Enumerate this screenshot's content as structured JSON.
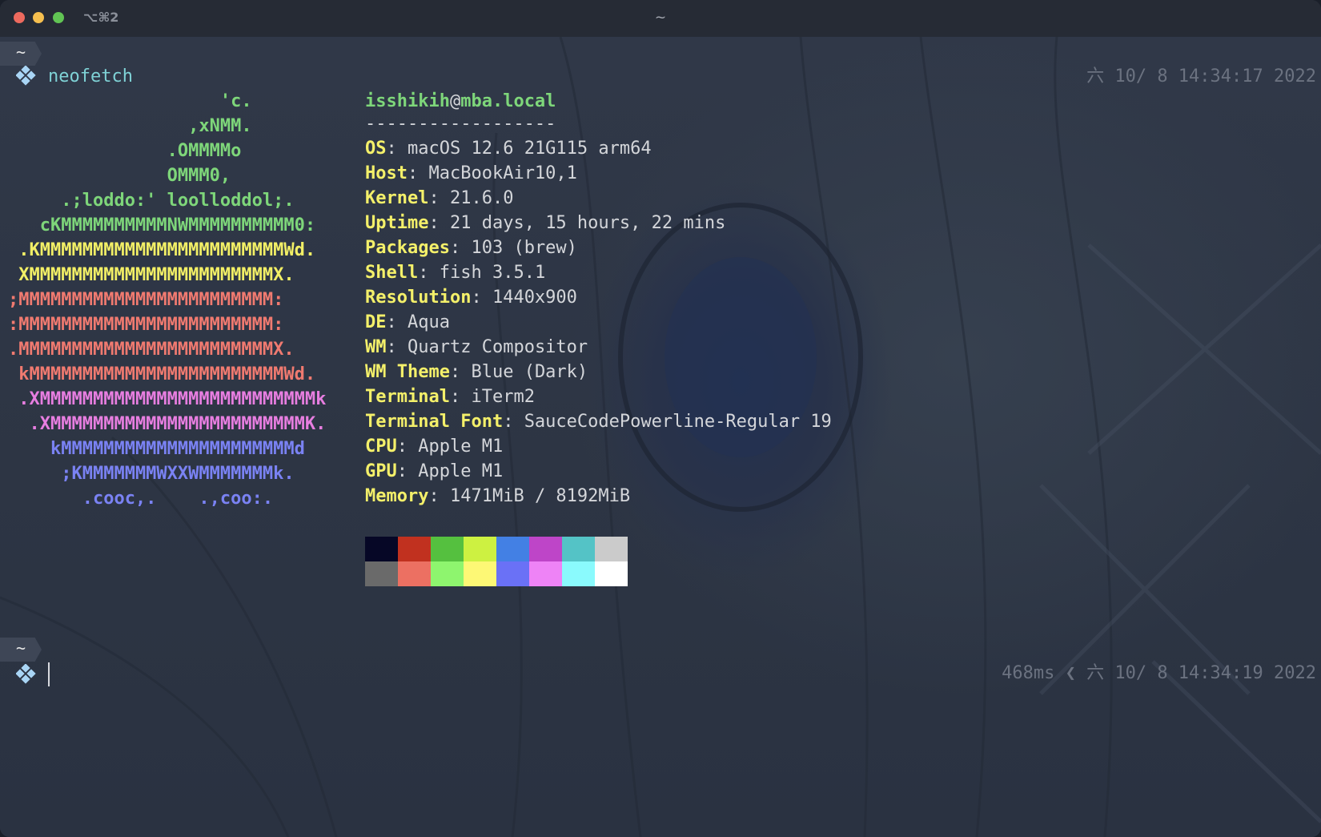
{
  "window": {
    "title": "~",
    "shortcut": "⌥⌘2"
  },
  "session1": {
    "cwd": "~",
    "command": "neofetch",
    "timestamp": "六 10/ 8 14:34:17 2022"
  },
  "ascii_logo": [
    {
      "text": "                    'c.",
      "color": "green"
    },
    {
      "text": "                 ,xNMM.",
      "color": "green"
    },
    {
      "text": "               .OMMMMo",
      "color": "green"
    },
    {
      "text": "               OMMM0,",
      "color": "green"
    },
    {
      "text": "     .;loddo:' loolloddol;.",
      "color": "green"
    },
    {
      "text": "   cKMMMMMMMMMMNWMMMMMMMMMM0:",
      "color": "green"
    },
    {
      "text": " .KMMMMMMMMMMMMMMMMMMMMMMMWd.",
      "color": "yellow"
    },
    {
      "text": " XMMMMMMMMMMMMMMMMMMMMMMMX.",
      "color": "yellow"
    },
    {
      "text": ";MMMMMMMMMMMMMMMMMMMMMMMM:",
      "color": "red"
    },
    {
      "text": ":MMMMMMMMMMMMMMMMMMMMMMMM:",
      "color": "red"
    },
    {
      "text": ".MMMMMMMMMMMMMMMMMMMMMMMMX.",
      "color": "red"
    },
    {
      "text": " kMMMMMMMMMMMMMMMMMMMMMMMMWd.",
      "color": "red"
    },
    {
      "text": " .XMMMMMMMMMMMMMMMMMMMMMMMMMMk",
      "color": "pink"
    },
    {
      "text": "  .XMMMMMMMMMMMMMMMMMMMMMMMMK.",
      "color": "pink"
    },
    {
      "text": "    kMMMMMMMMMMMMMMMMMMMMMMd",
      "color": "blue"
    },
    {
      "text": "     ;KMMMMMMMWXXWMMMMMMMk.",
      "color": "blue"
    },
    {
      "text": "       .cooc,.    .,coo:.",
      "color": "blue"
    }
  ],
  "sysinfo": {
    "user": "isshikih",
    "at": "@",
    "host": "mba.local",
    "separator": "------------------",
    "rows": [
      {
        "key": "OS",
        "value": "macOS 12.6 21G115 arm64"
      },
      {
        "key": "Host",
        "value": "MacBookAir10,1"
      },
      {
        "key": "Kernel",
        "value": "21.6.0"
      },
      {
        "key": "Uptime",
        "value": "21 days, 15 hours, 22 mins"
      },
      {
        "key": "Packages",
        "value": "103 (brew)"
      },
      {
        "key": "Shell",
        "value": "fish 3.5.1"
      },
      {
        "key": "Resolution",
        "value": "1440x900"
      },
      {
        "key": "DE",
        "value": "Aqua"
      },
      {
        "key": "WM",
        "value": "Quartz Compositor"
      },
      {
        "key": "WM Theme",
        "value": "Blue (Dark)"
      },
      {
        "key": "Terminal",
        "value": "iTerm2"
      },
      {
        "key": "Terminal Font",
        "value": "SauceCodePowerline-Regular 19"
      },
      {
        "key": "CPU",
        "value": "Apple M1"
      },
      {
        "key": "GPU",
        "value": "Apple M1"
      },
      {
        "key": "Memory",
        "value": "1471MiB / 8192MiB"
      }
    ],
    "key_separator": ": "
  },
  "palette": {
    "normal": [
      "#060726",
      "#c1311f",
      "#55c03f",
      "#cdf141",
      "#4380e4",
      "#be45c8",
      "#54c3c6",
      "#cbcbcb"
    ],
    "bright": [
      "#6a6a6a",
      "#ec7062",
      "#8ef56e",
      "#fdf875",
      "#6a71f6",
      "#ee83f6",
      "#8afafd",
      "#ffffff"
    ]
  },
  "session2": {
    "cwd": "~",
    "duration": "468ms",
    "chevron": "❮",
    "timestamp": "六 10/ 8 14:34:19 2022"
  },
  "colors": {
    "green": "#7ed67a",
    "yellow": "#f2ef66",
    "red": "#f07a70",
    "pink": "#e77ee0",
    "blue": "#7a82f3",
    "prompt_diamond": "#a9d5f5"
  }
}
